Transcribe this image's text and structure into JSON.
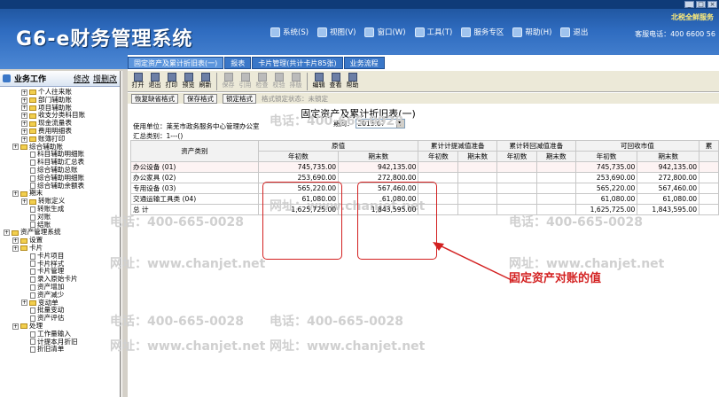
{
  "app": {
    "title": "G6-e财务管理系统",
    "brand": "北税全鲜服务",
    "hotline": "客服电话：400 6600 56",
    "window_buttons": [
      "_",
      "□",
      "×"
    ]
  },
  "top_menu": [
    {
      "label": "系统(S)",
      "icon": "system-icon"
    },
    {
      "label": "视图(V)",
      "icon": "view-icon"
    },
    {
      "label": "窗口(W)",
      "icon": "window-icon"
    },
    {
      "label": "工具(T)",
      "icon": "tools-icon"
    },
    {
      "label": "服务专区",
      "icon": "service-icon"
    },
    {
      "label": "帮助(H)",
      "icon": "help-icon"
    },
    {
      "label": "退出",
      "icon": "exit-icon"
    }
  ],
  "left": {
    "title": "业务工作",
    "modify": "修改",
    "manage": "增删改",
    "tree": [
      {
        "label": "个人往来账",
        "level": 2,
        "kind": "folder"
      },
      {
        "label": "部门辅助账",
        "level": 2,
        "kind": "folder"
      },
      {
        "label": "项目辅助账",
        "level": 2,
        "kind": "folder"
      },
      {
        "label": "收支分类科目账",
        "level": 2,
        "kind": "folder"
      },
      {
        "label": "现金流量表",
        "level": 2,
        "kind": "folder"
      },
      {
        "label": "费用明细表",
        "level": 2,
        "kind": "folder"
      },
      {
        "label": "账簿打印",
        "level": 2,
        "kind": "folder"
      },
      {
        "label": "综合辅助账",
        "level": 1,
        "kind": "folder"
      },
      {
        "label": "科目辅助明细账",
        "level": 3,
        "kind": "doc"
      },
      {
        "label": "科目辅助汇总表",
        "level": 3,
        "kind": "doc"
      },
      {
        "label": "综合辅助总账",
        "level": 3,
        "kind": "doc"
      },
      {
        "label": "综合辅助明细账",
        "level": 3,
        "kind": "doc"
      },
      {
        "label": "综合辅助余额表",
        "level": 3,
        "kind": "doc"
      },
      {
        "label": "期末",
        "level": 1,
        "kind": "folder"
      },
      {
        "label": "转账定义",
        "level": 2,
        "kind": "folder"
      },
      {
        "label": "转账生成",
        "level": 3,
        "kind": "doc"
      },
      {
        "label": "对账",
        "level": 3,
        "kind": "doc"
      },
      {
        "label": "结账",
        "level": 3,
        "kind": "doc"
      },
      {
        "label": "资产管理系统",
        "level": 0,
        "kind": "folder"
      },
      {
        "label": "设置",
        "level": 1,
        "kind": "folder"
      },
      {
        "label": "卡片",
        "level": 1,
        "kind": "folder"
      },
      {
        "label": "卡片项目",
        "level": 3,
        "kind": "doc"
      },
      {
        "label": "卡片样式",
        "level": 3,
        "kind": "doc"
      },
      {
        "label": "卡片管理",
        "level": 3,
        "kind": "doc"
      },
      {
        "label": "录入原始卡片",
        "level": 3,
        "kind": "doc"
      },
      {
        "label": "资产增加",
        "level": 3,
        "kind": "doc"
      },
      {
        "label": "资产减少",
        "level": 3,
        "kind": "doc"
      },
      {
        "label": "变动单",
        "level": 2,
        "kind": "folder"
      },
      {
        "label": "批量变动",
        "level": 3,
        "kind": "doc"
      },
      {
        "label": "资产评估",
        "level": 3,
        "kind": "doc"
      },
      {
        "label": "处理",
        "level": 1,
        "kind": "folder"
      },
      {
        "label": "工作量输入",
        "level": 3,
        "kind": "doc"
      },
      {
        "label": "计提本月折旧",
        "level": 3,
        "kind": "doc"
      },
      {
        "label": "折旧清单",
        "level": 3,
        "kind": "doc"
      }
    ]
  },
  "tabs": [
    {
      "label": "固定资产及累计折旧表(一)",
      "active": true
    },
    {
      "label": "报表",
      "active": false
    },
    {
      "label": "卡片管理(共计卡片85张)",
      "active": false
    },
    {
      "label": "业务流程",
      "active": false
    }
  ],
  "toolbar": [
    {
      "label": "打开",
      "icon": "open-icon",
      "enabled": true
    },
    {
      "label": "退出",
      "icon": "exit-icon",
      "enabled": true
    },
    {
      "label": "打印",
      "icon": "print-icon",
      "enabled": true
    },
    {
      "label": "预览",
      "icon": "preview-icon",
      "enabled": true
    },
    {
      "label": "刷新",
      "icon": "refresh-icon",
      "enabled": true
    },
    {
      "label": "保存",
      "icon": "save-icon",
      "enabled": false
    },
    {
      "label": "引用",
      "icon": "reference-icon",
      "enabled": false
    },
    {
      "label": "检查",
      "icon": "check-icon",
      "enabled": false
    },
    {
      "label": "校验",
      "icon": "verify-icon",
      "enabled": false
    },
    {
      "label": "排版",
      "icon": "layout-icon",
      "enabled": false
    },
    {
      "label": "编辑",
      "icon": "edit-icon",
      "enabled": true
    },
    {
      "label": "查看",
      "icon": "view-icon",
      "enabled": true
    },
    {
      "label": "帮助",
      "icon": "help-icon",
      "enabled": true
    }
  ],
  "format_bar": {
    "restore": "恢复缺省格式",
    "save": "保存格式",
    "lock": "锁定格式",
    "status": "格式锁定状态：未锁定"
  },
  "report": {
    "title": "固定资产及累计折旧表(一)",
    "unit": "使用单位：莱芜市政务服务中心管理办公室",
    "category": "汇总类别：1---()",
    "period_label": "期间：",
    "period_value": "2015.07",
    "headers": {
      "category": "资产类别",
      "original": "原值",
      "accumulated": "累计计提减值准备",
      "reversed": "累计转回减值准备",
      "recoverable": "可回收市值",
      "extra": "累"
    },
    "subheaders": {
      "begin": "年初数",
      "end": "期末数"
    },
    "rows": [
      {
        "name": "办公设备 (01)",
        "orig_begin": "745,735.00",
        "orig_end": "942,135.00",
        "acc_begin": "",
        "acc_end": "",
        "rev_begin": "",
        "rev_end": "",
        "rec_begin": "745,735.00",
        "rec_end": "942,135.00"
      },
      {
        "name": "办公家具 (02)",
        "orig_begin": "253,690.00",
        "orig_end": "272,800.00",
        "acc_begin": "",
        "acc_end": "",
        "rev_begin": "",
        "rev_end": "",
        "rec_begin": "253,690.00",
        "rec_end": "272,800.00"
      },
      {
        "name": "专用设备 (03)",
        "orig_begin": "565,220.00",
        "orig_end": "567,460.00",
        "acc_begin": "",
        "acc_end": "",
        "rev_begin": "",
        "rev_end": "",
        "rec_begin": "565,220.00",
        "rec_end": "567,460.00"
      },
      {
        "name": "交通运输工具类 (04)",
        "orig_begin": "61,080.00",
        "orig_end": "61,080.00",
        "acc_begin": "",
        "acc_end": "",
        "rev_begin": "",
        "rev_end": "",
        "rec_begin": "61,080.00",
        "rec_end": "61,080.00"
      }
    ],
    "total": {
      "name": "总  计",
      "orig_begin": "1,625,725.00",
      "orig_end": "1,843,595.00",
      "rec_begin": "1,625,725.00",
      "rec_end": "1,843,595.00"
    }
  },
  "watermark": {
    "phone": "电话：400-665-0028",
    "site": "网址：www.chanjet.net"
  },
  "annotation": "固定资产对账的值",
  "colors": {
    "annotation": "#d32020",
    "header_blue": "#2f6cc0"
  }
}
